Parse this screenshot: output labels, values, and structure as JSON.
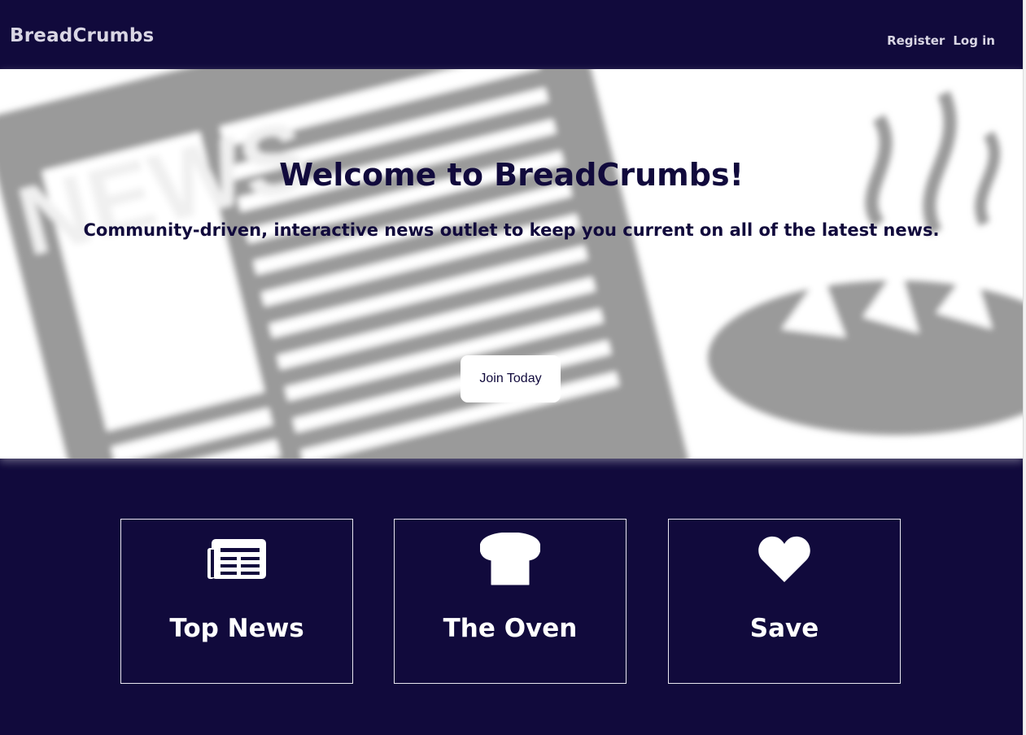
{
  "navbar": {
    "brand": "BreadCrumbs",
    "links": [
      "Register",
      "Log in"
    ]
  },
  "hero": {
    "title": "Welcome to BreadCrumbs!",
    "subtitle": "Community-driven, interactive news outlet to keep you current on all of the latest news.",
    "cta_label": "Join Today",
    "background_art": "blurred-newspaper-and-bread",
    "background_art_text": "NEWS"
  },
  "features": [
    {
      "title": "Top News",
      "icon": "newspaper-icon"
    },
    {
      "title": "The Oven",
      "icon": "bread-icon"
    },
    {
      "title": "Save",
      "icon": "heart-icon"
    }
  ],
  "colors": {
    "brand_navy": "#110a3c",
    "nav_text": "#d9d6e4",
    "hero_art_gray": "#9a9a9a",
    "white": "#ffffff"
  }
}
